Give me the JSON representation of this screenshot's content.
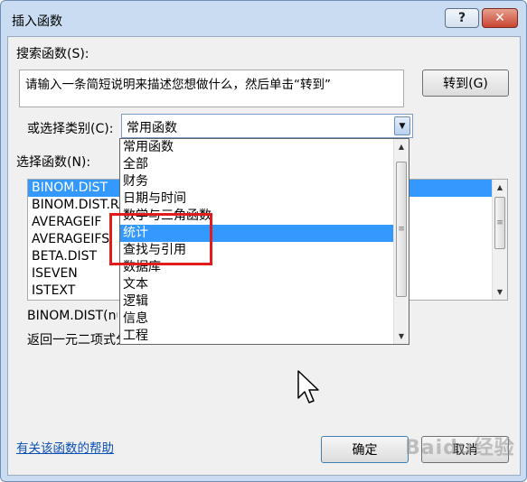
{
  "window": {
    "title": "插入函数",
    "help_label": "?",
    "close_label": "✕"
  },
  "search": {
    "label": "搜索函数(S):",
    "value": "请输入一条简短说明来描述您想做什么，然后单击“转到”",
    "go_button": "转到(G)"
  },
  "category": {
    "label": "或选择类别(C):",
    "selected": "常用函数",
    "options": [
      "常用函数",
      "全部",
      "财务",
      "日期与时间",
      "数学与三角函数",
      "统计",
      "查找与引用",
      "数据库",
      "文本",
      "逻辑",
      "信息",
      "工程"
    ],
    "highlighted_index": 5
  },
  "functions": {
    "label": "选择函数(N):",
    "items": [
      "BINOM.DIST",
      "BINOM.DIST.RANGE",
      "AVERAGEIF",
      "AVERAGEIFS",
      "BETA.DIST",
      "ISEVEN",
      "ISTEXT"
    ],
    "selected_index": 0
  },
  "description": {
    "signature": "BINOM.DIST(number_s,trials,probability_s,cumulative)",
    "text": "返回一元二项式分布的概率"
  },
  "footer": {
    "help_link": "有关该函数的帮助",
    "ok_button": "确定",
    "cancel_button": "取消"
  },
  "watermark": "Baidu经验",
  "colors": {
    "selection": "#3399ff",
    "annotation": "#e21b1b",
    "link": "#0b4fb5"
  }
}
